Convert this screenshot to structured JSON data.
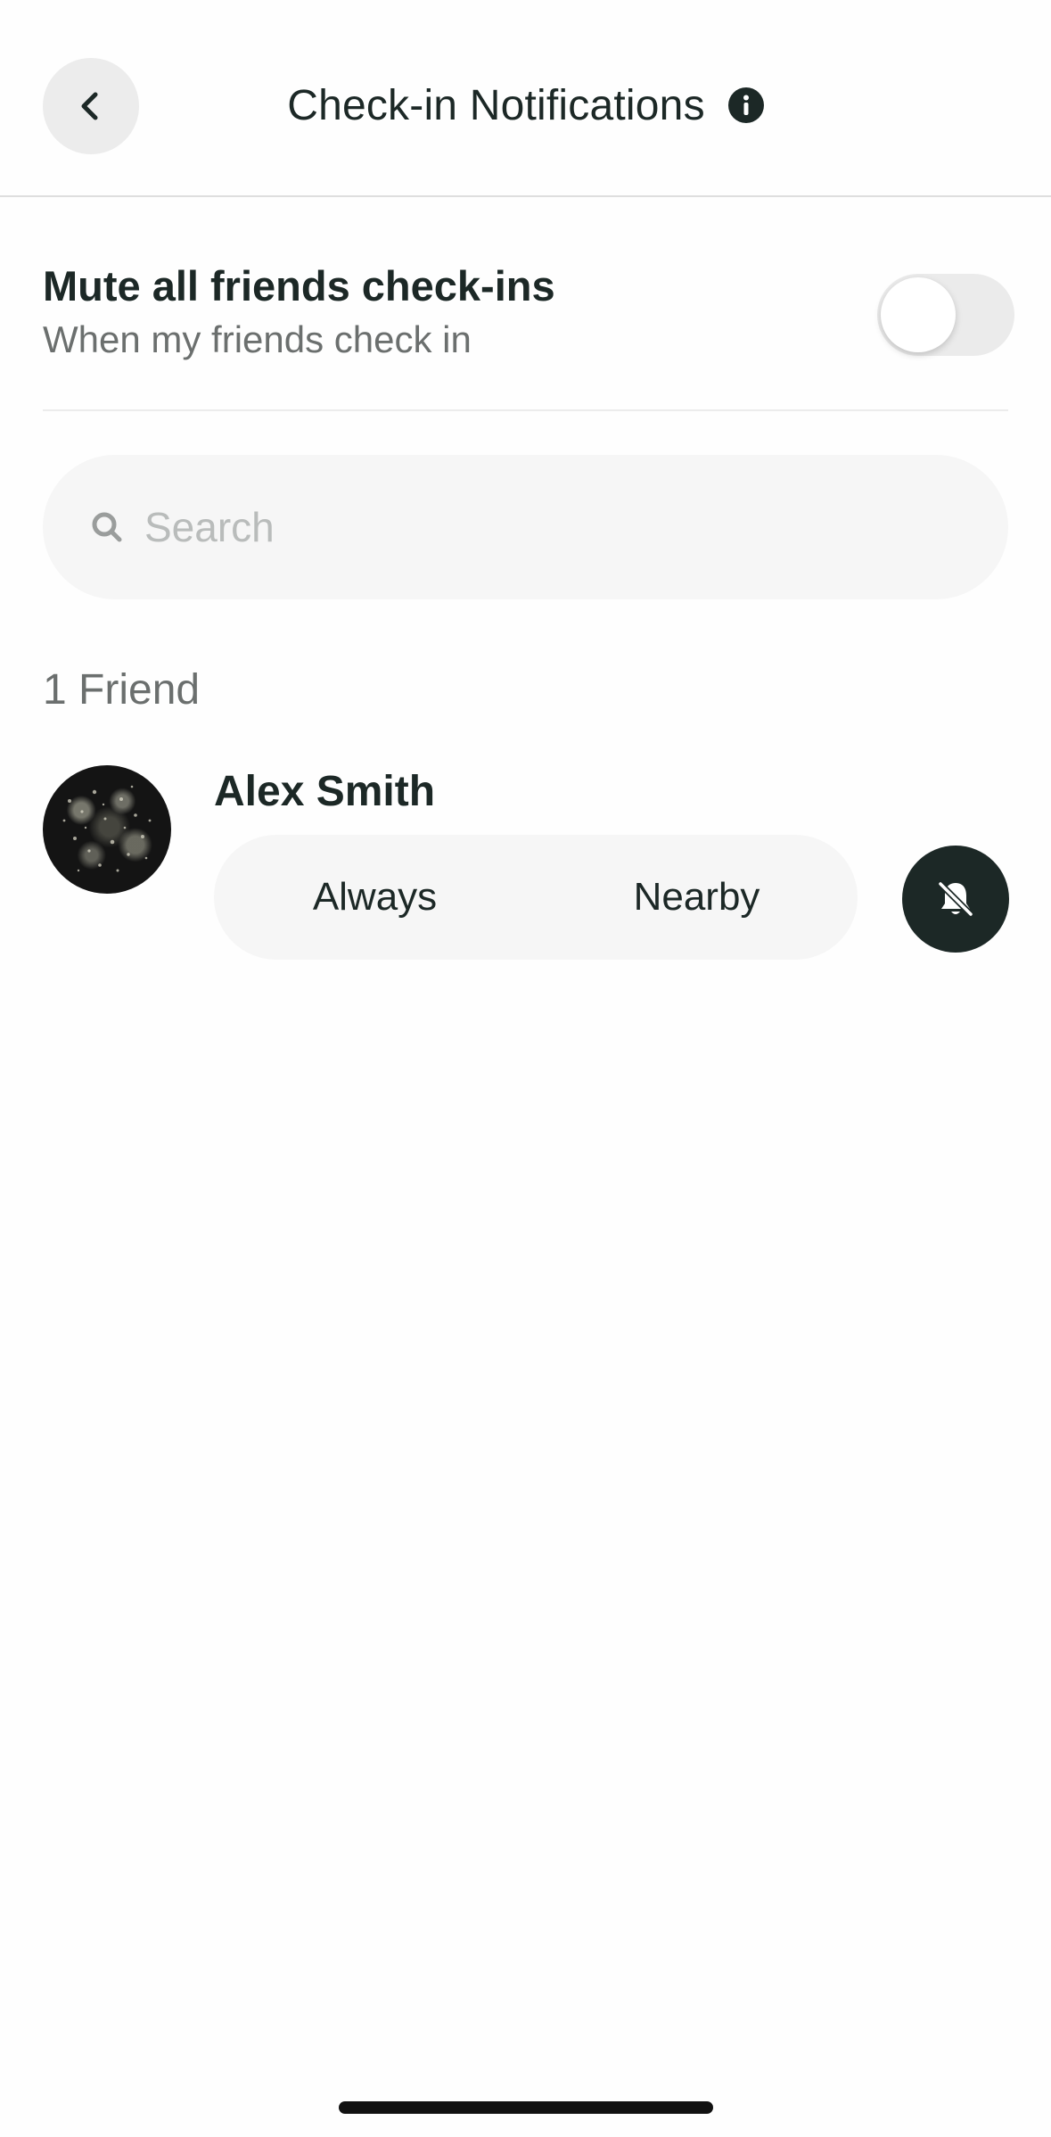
{
  "header": {
    "title": "Check-in Notifications",
    "back_icon": "chevron-left-icon",
    "info_icon": "info-icon"
  },
  "mute_all": {
    "title": "Mute all friends check-ins",
    "subtitle": "When my friends check in",
    "enabled": false
  },
  "search": {
    "placeholder": "Search",
    "value": "",
    "icon": "search-icon"
  },
  "friends": {
    "count_label": "1 Friend",
    "items": [
      {
        "name": "Alex Smith",
        "options": [
          "Always",
          "Nearby"
        ],
        "action_icon": "bell-off-icon"
      }
    ]
  },
  "colors": {
    "text_primary": "#1c2826",
    "text_secondary": "#6b6f6e",
    "surface": "#f6f6f6",
    "accent_dark": "#1c2826"
  }
}
